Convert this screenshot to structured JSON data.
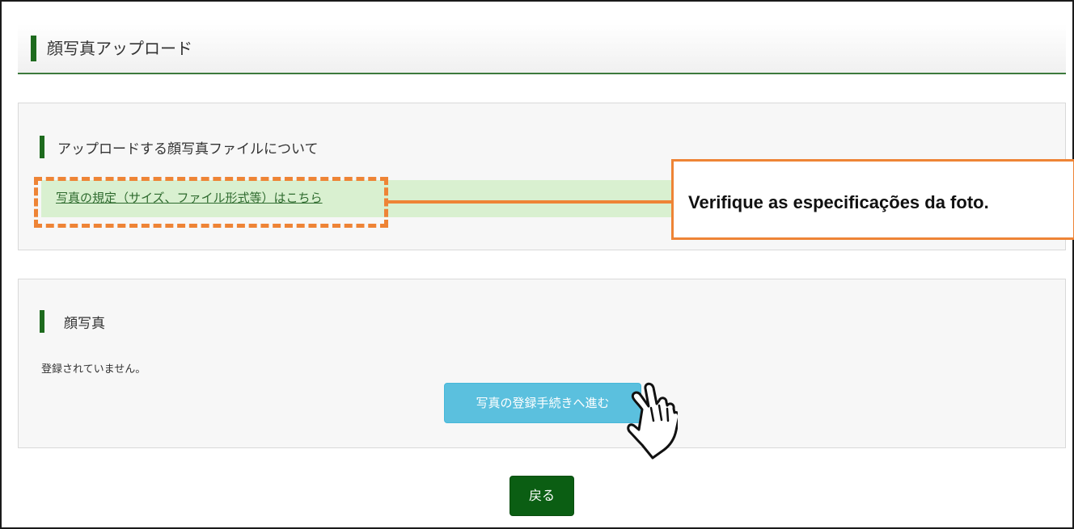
{
  "header": {
    "title": "顔写真アップロード"
  },
  "upload_info_section": {
    "title": "アップロードする顔写真ファイルについて",
    "spec_link": "写真の規定（サイズ、ファイル形式等）はこちら"
  },
  "annotation": {
    "callout_text": "Verifique as especificações da foto."
  },
  "photo_section": {
    "title": "顔写真",
    "status": "登録されていません。",
    "register_button": "写真の登録手続きへ進む"
  },
  "footer": {
    "back_button": "戻る"
  },
  "colors": {
    "accent_green": "#1e6b1e",
    "link_row_bg": "#d9f0d0",
    "annotation_orange": "#ee8436",
    "register_button": "#5bc0de",
    "back_button": "#0b5e13"
  },
  "icons": {
    "pointer": "hand-pointer-icon"
  }
}
